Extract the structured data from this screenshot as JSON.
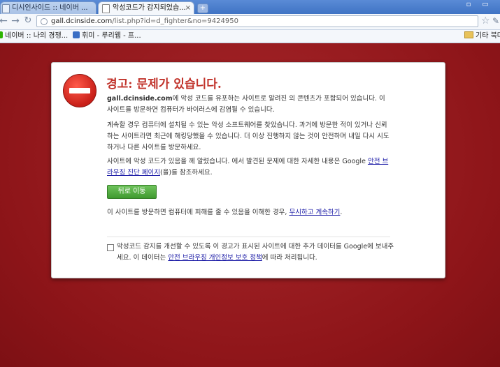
{
  "browser": {
    "tabs": [
      {
        "label": "디시인사이드 :: 네이버 ...",
        "active": false
      },
      {
        "label": "악성코드가 감지되었습...",
        "active": true
      }
    ],
    "tab_close": "×",
    "new_tab": "+",
    "window_controls": [
      "▫",
      "▭"
    ],
    "address": {
      "host": "gall.dcinside.com",
      "path": "/list.php?id=d_fighter&no=9424950"
    },
    "bookmarks": [
      "네이버 :: 나의 경쟁...",
      "휘미 - 루리웹 - 프...",
      "기타 북마"
    ]
  },
  "warning": {
    "title": "경고: 문제가 있습니다.",
    "p1_host": "gall.dcinside.com",
    "p1_text": "에 악성 코드를 유포하는 사이트로 알려진                   의 콘텐츠가 포함되어 있습니다. 이 사이트를 방문하면 컴퓨터가 바이러스에 감염될 수 있습니다.",
    "p2": "계속할 경우 컴퓨터에 설치될 수 있는 악성 소프트웨어를 찾았습니다. 과거에 방문한 적이 있거나 신뢰하는 사이트라면 최근에 해킹당했을 수 있습니다. 더 이상 진행하지 않는 것이 안전하며 내일 다시 시도하거나 다른 사이트를 방문하세요.",
    "p3_before": "사이트에 악성 코드가 있음을                    께 알렸습니다.                    에서 발견된 문제에 대한 자세한 내용은 Google ",
    "p3_link": "안전 브라우징 진단 페이지",
    "p3_after": "(을)를 참조하세요.",
    "back_button": "뒤로 이동",
    "p4_text": "이 사이트를 방문하면 컴퓨터에 피해를 줄 수 있음을 이해한 경우, ",
    "p4_link": "무시하고 계속하기",
    "p4_end": ".",
    "p5_before": "악성코드 감지를 개선할 수 있도록 이 경고가 표시된 사이트에 대한 추가 데이터를 Google에 보내주세요. 이 데이터는 ",
    "p5_link": "안전 브라우징 개인정보 보호 정책",
    "p5_after": "에 따라 처리됩니다."
  },
  "colors": {
    "background": "#9a1a1e",
    "title": "#c1332b",
    "button": "#4ea63c",
    "link": "#1a1aa6"
  }
}
